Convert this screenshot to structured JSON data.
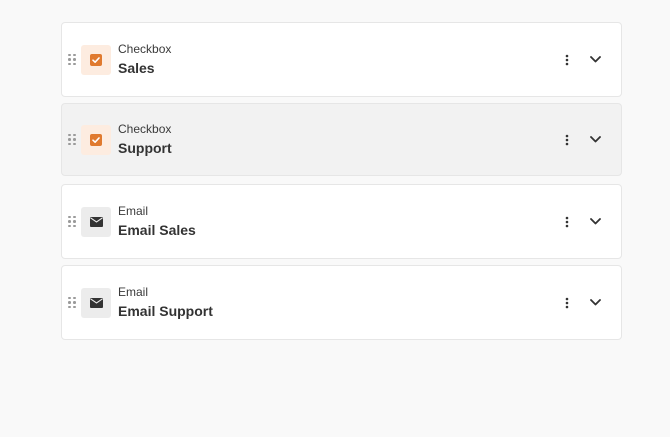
{
  "fields": [
    {
      "type": "Checkbox",
      "name": "Sales",
      "icon": "checkbox-icon",
      "hover": false
    },
    {
      "type": "Checkbox",
      "name": "Support",
      "icon": "checkbox-icon",
      "hover": true
    },
    {
      "type": "Email",
      "name": "Email Sales",
      "icon": "envelope-icon",
      "hover": false
    },
    {
      "type": "Email",
      "name": "Email Support",
      "icon": "envelope-icon",
      "hover": false
    }
  ],
  "colors": {
    "checkbox_accent": "#e07a2f",
    "checkbox_bg": "#fdece0",
    "email_icon": "#333333",
    "email_bg": "#ececec"
  }
}
